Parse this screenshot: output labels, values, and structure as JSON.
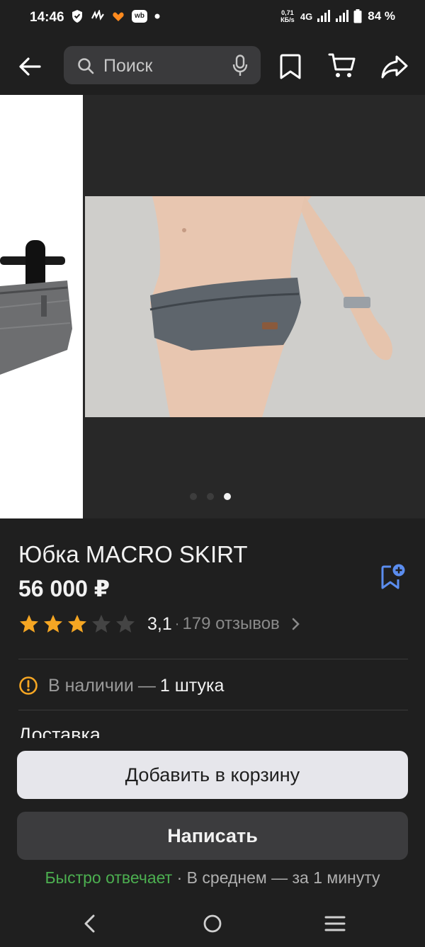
{
  "status_bar": {
    "time": "14:46",
    "network_speed_value": "0,71",
    "network_speed_unit": "КБ/s",
    "network_type": "4G",
    "battery": "84 %",
    "app_badge": "wb"
  },
  "top_bar": {
    "search_placeholder": "Поиск",
    "icons": [
      "back-arrow-icon",
      "search-icon",
      "mic-icon",
      "bookmark-icon",
      "cart-icon",
      "share-icon"
    ]
  },
  "gallery": {
    "page_count": 3,
    "active_index": 2
  },
  "product": {
    "title": "Юбка MACRO SKIRT",
    "price": "56 000 ₽",
    "rating": {
      "value": "3,1",
      "stars_filled": 3,
      "stars_total": 5,
      "separator": "·",
      "reviews": "179 отзывов"
    },
    "stock": {
      "label": "В наличии",
      "dash": "—",
      "value": "1 штука"
    },
    "delivery_label": "Доставка"
  },
  "actions": {
    "add_to_cart": "Добавить в корзину",
    "write": "Написать"
  },
  "seller_response": {
    "fast": "Быстро отвечает",
    "separator": " · ",
    "average": "В среднем  — за 1 минуту"
  },
  "colors": {
    "background": "#1f1f1f",
    "accent_blue": "#5b8def",
    "star_filled": "#f5a623",
    "star_empty": "#4a4a4a",
    "warning": "#f5a623",
    "green": "#4caf50"
  }
}
